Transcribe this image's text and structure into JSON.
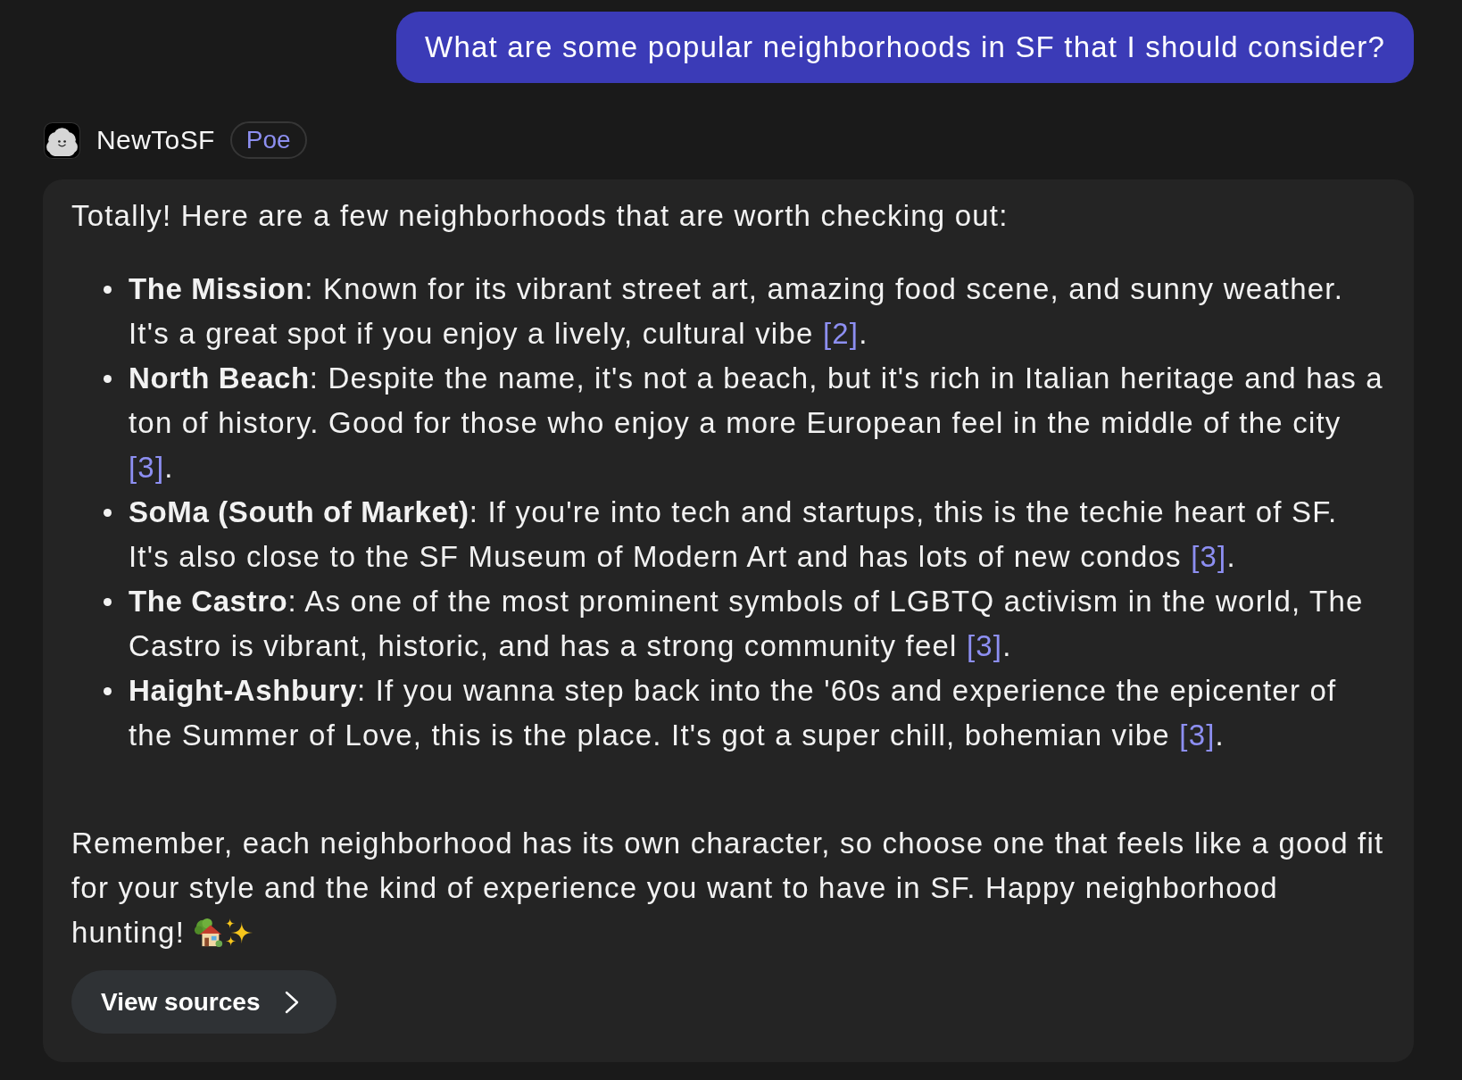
{
  "user_message": {
    "text": "What are some popular neighborhoods in SF that I should consider?"
  },
  "bot": {
    "name": "NewToSF",
    "badge": "Poe"
  },
  "answer": {
    "intro": "Totally! Here are a few neighborhoods that are worth checking out:",
    "items": [
      {
        "text": "**The Mission**: Known for its vibrant street art, amazing food scene, and sunny weather. It's a great spot if you enjoy a lively, cultural vibe",
        "citation": "[2]",
        "after": "."
      },
      {
        "text": "**North Beach**: Despite the name, it's not a beach, but it's rich in Italian heritage and has a ton of history. Good for those who enjoy a more European feel in the middle of the city",
        "citation": "[3]",
        "after": "."
      },
      {
        "text": "**SoMa (South of Market)**: If you're into tech and startups, this is the techie heart of SF. It's also close to the SF Museum of Modern Art and has lots of new condos",
        "citation": "[3]",
        "after": "."
      },
      {
        "text": "**The Castro**: As one of the most prominent symbols of LGBTQ activism in the world, The Castro is vibrant, historic, and has a strong community feel",
        "citation": "[3]",
        "after": "."
      },
      {
        "text": "**Haight-Ashbury**: If you wanna step back into the '60s and experience the epicenter of the Summer of Love, this is the place. It's got a super chill, bohemian vibe",
        "citation": "[3]",
        "after": "."
      }
    ],
    "closing": "Remember, each neighborhood has its own character, so choose one that feels like a good fit for your style and the kind of experience you want to have in SF. Happy neighborhood hunting!",
    "view_sources_button": "View sources"
  }
}
